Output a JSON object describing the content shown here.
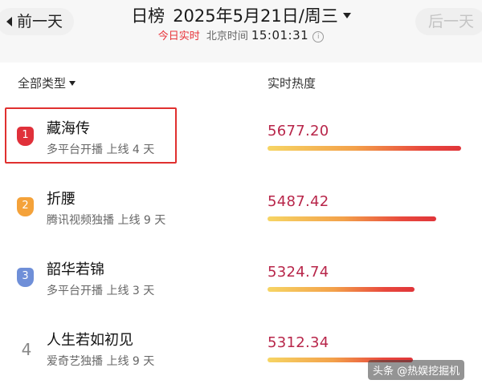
{
  "header": {
    "prev_label": "前一天",
    "next_label": "后一天",
    "board_title": "日榜",
    "date": "2025年5月21日/周三",
    "realtime_label": "今日实时",
    "time_zone_label": "北京时间",
    "time": "15:01:31"
  },
  "columns": {
    "type_label": "全部类型",
    "heat_label": "实时热度"
  },
  "items": [
    {
      "rank": "1",
      "title": "藏海传",
      "meta": "多平台开播 上线 4 天",
      "heat": "5677.20",
      "heat_value": 5677.2,
      "badge_color": "#e0303a"
    },
    {
      "rank": "2",
      "title": "折腰",
      "meta": "腾讯视频独播 上线 9 天",
      "heat": "5487.42",
      "heat_value": 5487.42,
      "badge_color": "#f4a23a"
    },
    {
      "rank": "3",
      "title": "韶华若锦",
      "meta": "多平台开播 上线 3 天",
      "heat": "5324.74",
      "heat_value": 5324.74,
      "badge_color": "#6f8fd8"
    },
    {
      "rank": "4",
      "title": "人生若如初见",
      "meta": "爱奇艺独播 上线 9 天",
      "heat": "5312.34",
      "heat_value": 5312.34,
      "badge_color": ""
    }
  ],
  "heat_scale": {
    "min": 4200,
    "max": 5677.2
  },
  "watermark": "头条 @热娱挖掘机",
  "colors": {
    "accent": "#e8343a",
    "heat_text": "#b8264a"
  }
}
